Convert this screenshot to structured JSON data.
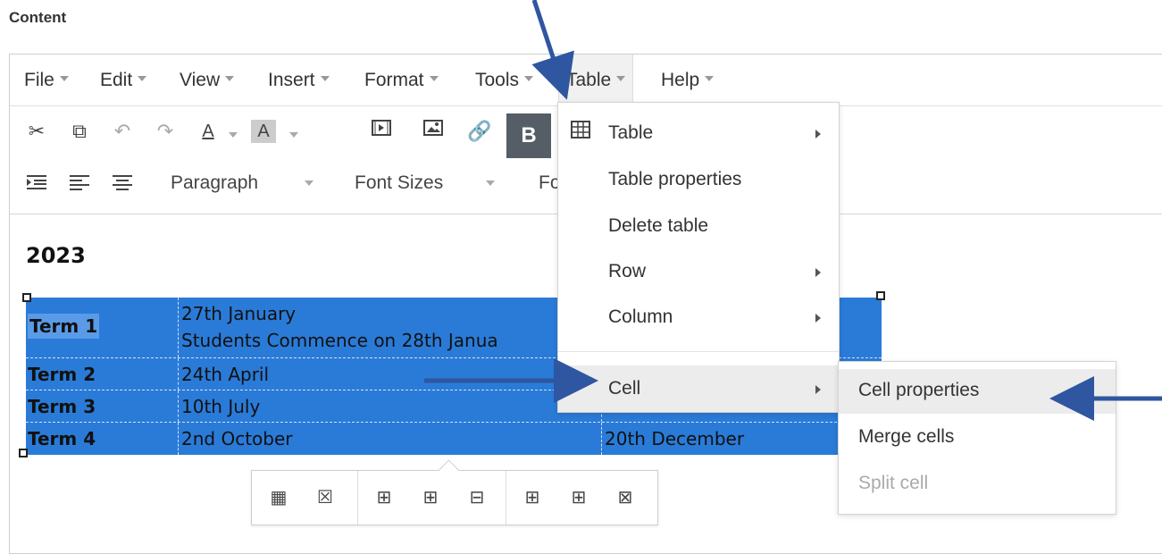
{
  "content_label": "Content",
  "menubar": {
    "items": [
      "File",
      "Edit",
      "View",
      "Insert",
      "Format",
      "Tools",
      "Table",
      "Help"
    ]
  },
  "toolbar": {
    "paragraph": "Paragraph",
    "font_sizes": "Font Sizes",
    "font_family_partial": "Fo",
    "bold": "B",
    "text_color_glyph": "A",
    "bg_color_glyph": "A"
  },
  "document": {
    "year": "2023",
    "rows": [
      {
        "term": "Term 1",
        "date_line1": "27th January",
        "date_line2": "Students Commence on 28th Janua",
        "end": ""
      },
      {
        "term": "Term 2",
        "date": "24th April",
        "end": ""
      },
      {
        "term": "Term 3",
        "date": "10th July",
        "end": ""
      },
      {
        "term": "Term 4",
        "date": "2nd October",
        "end": "20th December"
      }
    ]
  },
  "table_menu": {
    "items": [
      {
        "label": "Table",
        "submenu": true,
        "icon": "table-grid-icon"
      },
      {
        "label": "Table properties",
        "submenu": false
      },
      {
        "label": "Delete table",
        "submenu": false
      },
      {
        "label": "Row",
        "submenu": true
      },
      {
        "label": "Column",
        "submenu": true
      },
      {
        "label": "Cell",
        "submenu": true
      }
    ]
  },
  "cell_menu": {
    "items": [
      {
        "label": "Cell properties",
        "state": "hover"
      },
      {
        "label": "Merge cells",
        "state": "normal"
      },
      {
        "label": "Split cell",
        "state": "disabled"
      }
    ]
  },
  "colors": {
    "selection": "#2a7bd8",
    "arrow": "#2f56a0",
    "bold_button": "#555d66"
  }
}
